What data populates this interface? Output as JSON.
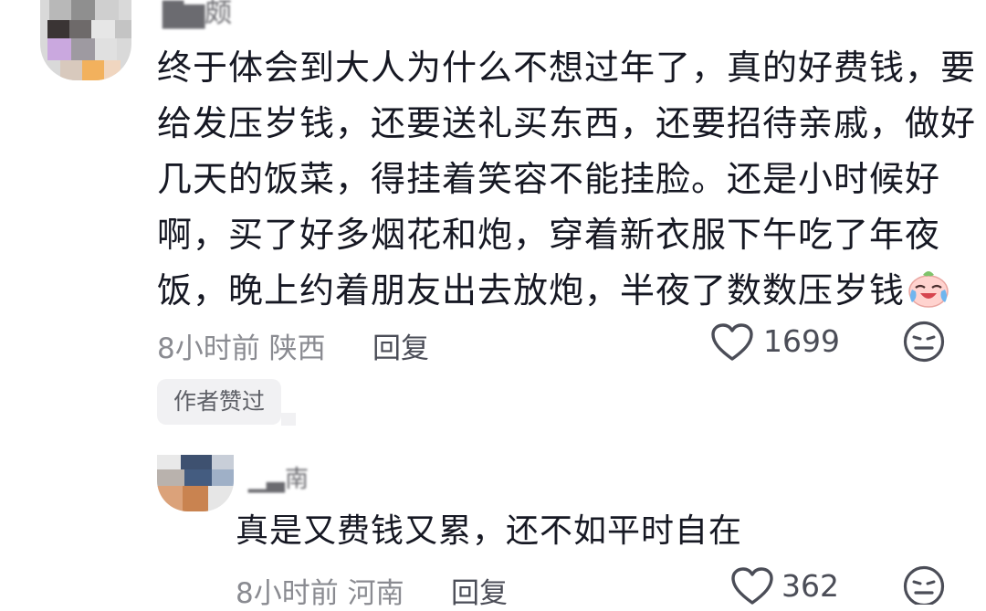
{
  "comment": {
    "username": "▇▆颇",
    "lines": [
      "终于体会到大人为什么不想过年了，真的好费钱，要",
      "给发压岁钱，还要送礼买东西，还要招待亲戚，做好",
      "几天的饭菜，得挂着笑容不能挂脸。还是小时候好",
      "啊，买了好多烟花和炮，穿着新衣服下午吃了年夜",
      "饭，晚上约着朋友出去放炮，半夜了数数压岁钱"
    ],
    "time": "8小时前",
    "location": "陕西",
    "reply_label": "回复",
    "like_count": "1699",
    "author_badge": "作者赞过",
    "emoji_icon": "crying-laughing-emoji-icon"
  },
  "reply": {
    "username": "▁▃南",
    "text": "真是又费钱又累，还不如平时自在",
    "time": "8小时前",
    "location": "河南",
    "reply_label": "回复",
    "like_count": "362"
  },
  "icons": {
    "like": "heart-outline-icon",
    "dislike": "meh-face-icon"
  }
}
